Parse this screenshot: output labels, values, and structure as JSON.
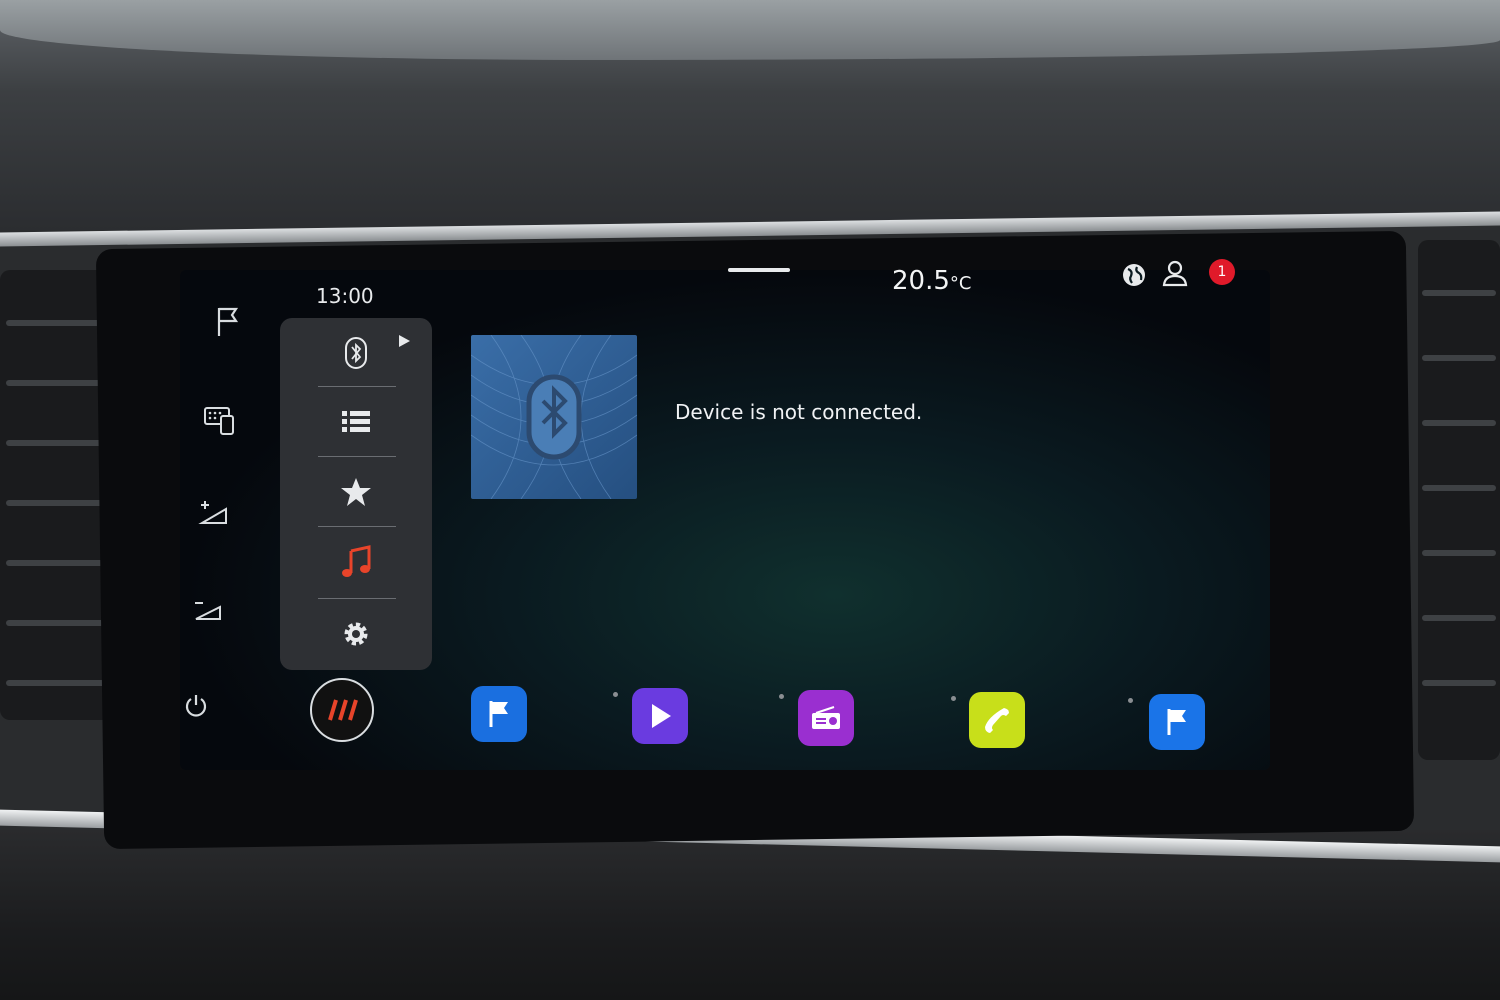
{
  "status": {
    "time": "13:00",
    "temperature": "20.5",
    "temperature_unit": "°C",
    "notification_count": "1"
  },
  "media": {
    "message": "Device is not connected."
  },
  "side_buttons": [
    "flag-icon",
    "keyboard-phone-icon",
    "brightness-up-icon",
    "brightness-down-icon",
    "power-icon"
  ],
  "menu_items": [
    "bluetooth-icon",
    "list-icon",
    "star-icon",
    "music-note-icon",
    "settings-gear-icon"
  ],
  "dock_apps": [
    {
      "icon": "navigation-flag-icon",
      "color": "#1a6fe0"
    },
    {
      "icon": "play-icon",
      "color": "#6a3be0"
    },
    {
      "icon": "radio-icon",
      "color": "#9a2fd0"
    },
    {
      "icon": "phone-icon",
      "color": "#c8df1a"
    },
    {
      "icon": "navigation-flag-icon",
      "color": "#1a74e8"
    }
  ],
  "colors": {
    "accent_red": "#e8442a",
    "badge_red": "#e01a2a"
  }
}
